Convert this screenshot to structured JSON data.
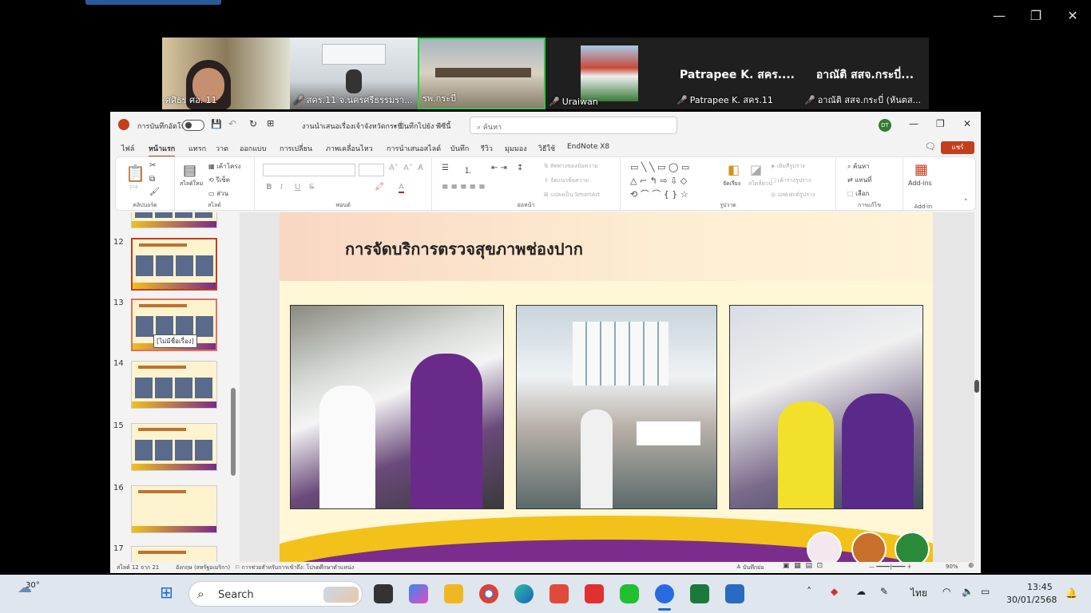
{
  "zoom_window": {
    "controls": [
      "—",
      "❐",
      "✕"
    ]
  },
  "participants": [
    {
      "name": "ศศิธร ศอ. 11",
      "muted": false
    },
    {
      "name": "สคร.11 จ.นครศรีธรรมรา...",
      "muted": true
    },
    {
      "name": "รพ.กระบี่",
      "muted": false
    },
    {
      "name": "Uraiwan",
      "muted": true
    },
    {
      "title": "Patrapee K. สคร....",
      "name": "Patrapee K. สคร.11",
      "muted": true
    },
    {
      "title": "อาณัติ สสจ.กระบี่...",
      "name": "อาณัติ สสจ.กระบี่ (หันตส...",
      "muted": true
    }
  ],
  "ppt": {
    "autosave_label": "การบันทึกอัตโนมัติ",
    "doc_title": "งานนำเสนอเรื่องเจ้าจังหวัดกระบี่...",
    "save_status": "• บันทึกไปยัง พีซีนี้",
    "search_placeholder": "ค้นหา",
    "user_initials": "DT",
    "tabs": [
      "ไฟล์",
      "หน้าแรก",
      "แทรก",
      "วาด",
      "ออกแบบ",
      "การเปลี่ยน",
      "ภาพเคลื่อนไหว",
      "การนำเสนอสไลด์",
      "บันทึก",
      "รีวิว",
      "มุมมอง",
      "วิธีใช้",
      "EndNote X8"
    ],
    "share_label": "แชร์",
    "ribbon": {
      "clipboard": {
        "label": "คลิปบอร์ด",
        "paste": "วาง"
      },
      "slides": {
        "label": "สไลด์",
        "new_slide": "สไลด์ใหม่",
        "layout": "เค้าโครง",
        "reset": "รีเซ็ต",
        "section": "ส่วน"
      },
      "font": {
        "label": "ฟอนต์",
        "bold": "B",
        "italic": "I",
        "underline": "U",
        "strike": "S"
      },
      "paragraph": {
        "label": "ย่อหน้า",
        "text_dir": "ทิศทางของข้อความ",
        "align_text": "จัดแนวข้อความ",
        "smartart": "แปลงเป็น SmartArt"
      },
      "drawing": {
        "label": "รูปวาด",
        "arrange": "จัดเรียง",
        "quick_styles": "สไตล์ด่วน",
        "fill": "เติมสีรูปร่าง",
        "outline": "เค้าร่างรูปร่าง",
        "effects": "เอฟเฟกต์รูปร่าง"
      },
      "editing": {
        "label": "การแก้ไข",
        "find": "ค้นหา",
        "replace": "แทนที่",
        "select": "เลือก"
      },
      "addins": {
        "label": "Add-in",
        "addins": "Add-ins"
      }
    },
    "thumbnails": [
      {
        "num": "12",
        "selected": true
      },
      {
        "num": "13",
        "selected": false
      },
      {
        "num": "14",
        "selected": false
      },
      {
        "num": "15",
        "selected": false
      },
      {
        "num": "16",
        "selected": false
      },
      {
        "num": "17",
        "selected": false
      }
    ],
    "tooltip": "[ไม่มีชื่อเรื่อง]",
    "slide": {
      "title": "การจัดบริการตรวจสุขภาพช่องปาก"
    },
    "statusbar": {
      "slide_pos": "สไลด์ 12 จาก 21",
      "language": "อังกฤษ (สหรัฐอเมริกา)",
      "accessibility": "การช่วยสำหรับการเข้าถึง: โปรดศึกษาตำแหน่ง",
      "notes": "บันทึกย่อ",
      "zoom": "90%"
    }
  },
  "taskbar": {
    "weather": "30°",
    "search": "Search",
    "lang": "ไทย",
    "time": "13:45",
    "date": "30/01/2568"
  },
  "colors": {
    "accent": "#c43e1c",
    "zoom_green": "#2ecc40"
  }
}
